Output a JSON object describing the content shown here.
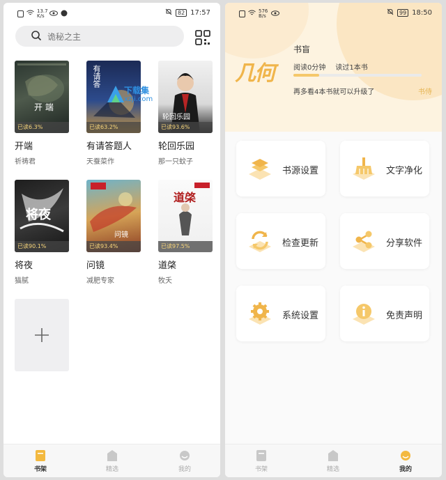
{
  "status_left": {
    "time": "17:57",
    "speed": "13.7 K/s",
    "battery": "82"
  },
  "status_right": {
    "time": "18:50",
    "speed": "576 B/s",
    "battery": "99"
  },
  "search": {
    "placeholder": "诡秘之主"
  },
  "books": [
    {
      "title": "开端",
      "author": "祈祷君",
      "progress": "已读6.3%",
      "cover_text": "开 端"
    },
    {
      "title": "有请答题人",
      "author": "天蚕菜作",
      "progress": "已读63.2%",
      "cover_text": "有请答"
    },
    {
      "title": "轮回乐园",
      "author": "那一只蚊子",
      "progress": "已读93.6%",
      "cover_text": "轮回乐园"
    },
    {
      "title": "将夜",
      "author": "猫腻",
      "progress": "已读90.1%",
      "cover_text": "将夜"
    },
    {
      "title": "问镜",
      "author": "减肥专家",
      "progress": "已读93.4%",
      "cover_text": "问镜"
    },
    {
      "title": "道棨",
      "author": "牧夭",
      "progress": "已读97.5%",
      "cover_text": "道棨"
    }
  ],
  "watermark": {
    "text": "下载集",
    "url": "xzji.com"
  },
  "tabs_left": [
    {
      "label": "书架",
      "icon": "bookshelf-icon",
      "active": true
    },
    {
      "label": "精选",
      "icon": "featured-icon",
      "active": false
    },
    {
      "label": "我的",
      "icon": "profile-icon",
      "active": false
    }
  ],
  "tabs_right": [
    {
      "label": "书架",
      "icon": "bookshelf-icon",
      "active": false
    },
    {
      "label": "精选",
      "icon": "featured-icon",
      "active": false
    },
    {
      "label": "我的",
      "icon": "profile-icon",
      "active": true
    }
  ],
  "profile": {
    "logo_text": "几何",
    "name": "书盲",
    "read_time": "阅读0分钟",
    "books_read": "读过1本书",
    "hint": "再多看4本书就可以升级了",
    "level": "书侍",
    "level_progress": 0.2
  },
  "menu": [
    {
      "label": "书源设置",
      "icon": "layers-icon"
    },
    {
      "label": "文字净化",
      "icon": "broom-icon"
    },
    {
      "label": "检查更新",
      "icon": "refresh-icon"
    },
    {
      "label": "分享软件",
      "icon": "share-icon"
    },
    {
      "label": "系统设置",
      "icon": "gear-icon"
    },
    {
      "label": "免责声明",
      "icon": "info-icon"
    }
  ],
  "colors": {
    "accent": "#f5c86a",
    "accent_dark": "#e6a93a",
    "progress_text": "#f7d57a"
  }
}
